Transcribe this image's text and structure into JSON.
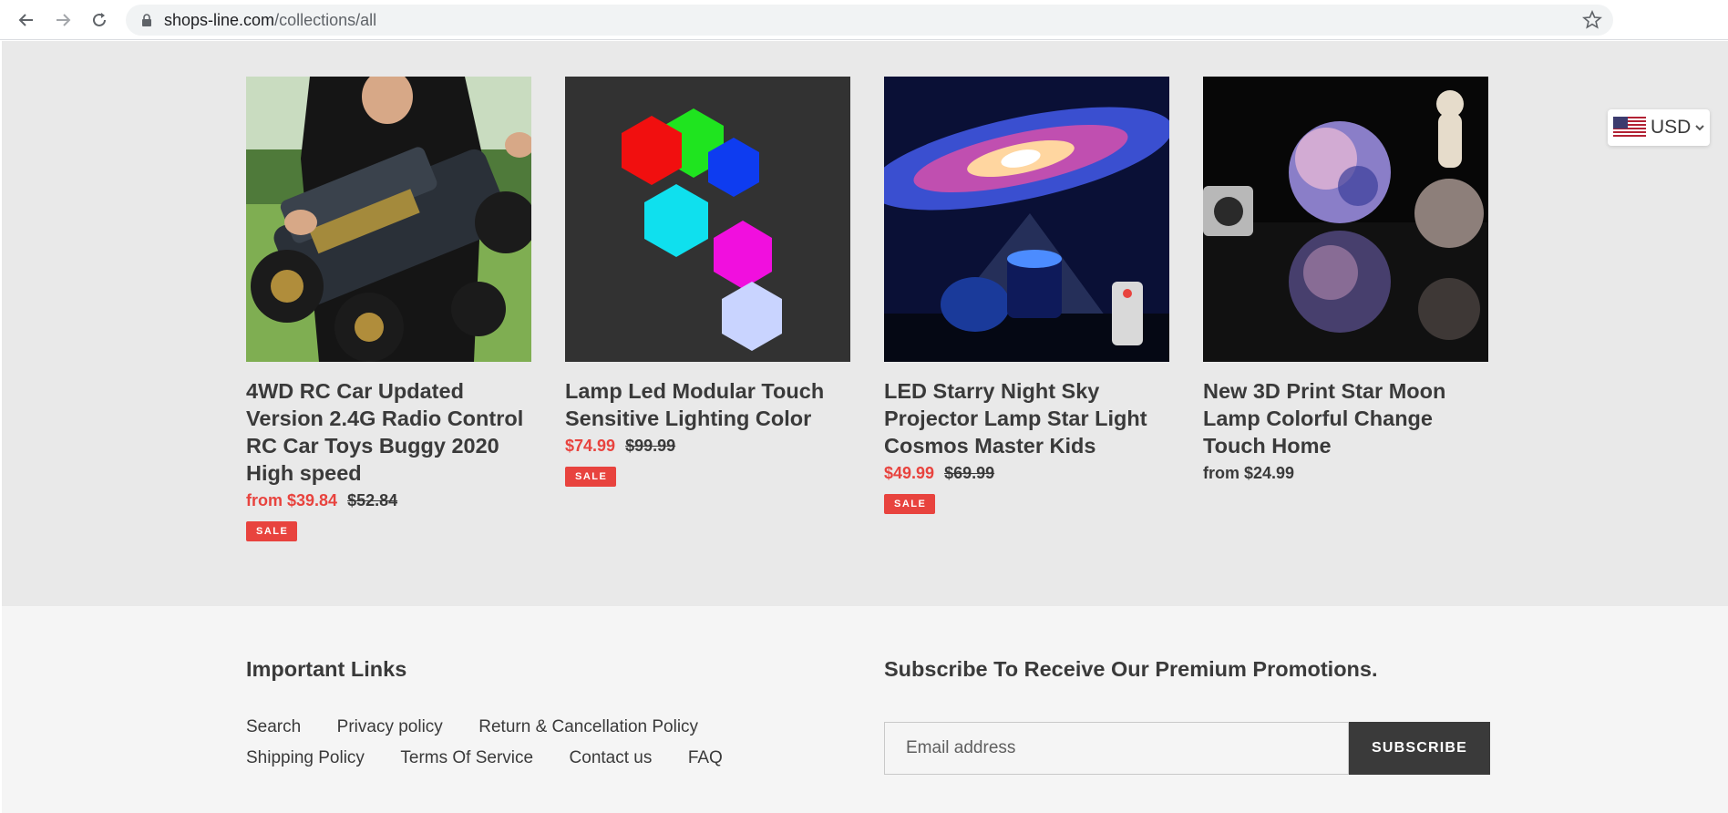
{
  "browser": {
    "url_domain": "shops-line.com",
    "url_path": "/collections/all"
  },
  "currency": {
    "selected": "USD",
    "flag_icon": "us-flag-icon"
  },
  "products": [
    {
      "title": "4WD RC Car Updated Version 2.4G Radio Control RC Car Toys Buggy 2020 High speed",
      "price": "from $39.84",
      "compare_price": "$52.84",
      "badge": "SALE"
    },
    {
      "title": "Lamp Led Modular Touch Sensitive Lighting Color",
      "price": "$74.99",
      "compare_price": "$99.99",
      "badge": "SALE"
    },
    {
      "title": "LED Starry Night Sky Projector Lamp Star Light Cosmos Master Kids",
      "price": "$49.99",
      "compare_price": "$69.99",
      "badge": "SALE"
    },
    {
      "title": "New 3D Print Star Moon Lamp Colorful Change Touch Home",
      "price": "from $24.99"
    }
  ],
  "footer": {
    "links_heading": "Important Links",
    "links": [
      "Search",
      "Privacy policy",
      "Return & Cancellation Policy",
      "Shipping Policy",
      "Terms Of Service",
      "Contact us",
      "FAQ"
    ],
    "subscribe_heading": "Subscribe To Receive Our Premium Promotions.",
    "email_placeholder": "Email address",
    "subscribe_label": "SUBSCRIBE"
  },
  "colors": {
    "sale_red": "#e8433e",
    "text_dark": "#3a3a3a",
    "grid_bg": "#e9e9e9",
    "footer_bg": "#f5f5f5"
  }
}
